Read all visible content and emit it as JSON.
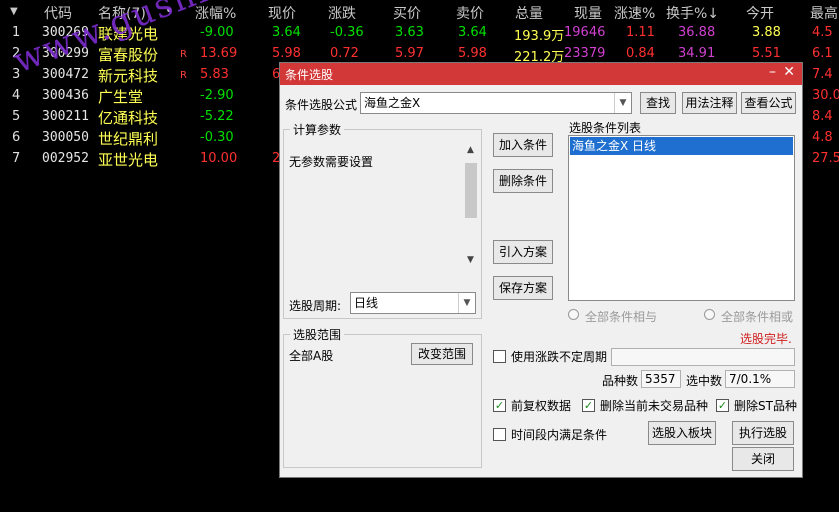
{
  "header": {
    "sort_arrow": "▼",
    "columns": [
      "代码",
      "名称(7)",
      "•",
      "涨幅%",
      "现价",
      "涨跌",
      "买价",
      "卖价",
      "总量",
      "现量",
      "涨速%",
      "换手%↓",
      "今开",
      "最高"
    ]
  },
  "rows": [
    {
      "idx": "1",
      "code": "300269",
      "name": "联建光电",
      "flag": "",
      "pct": "-9.00",
      "price": "3.64",
      "chg": "-0.36",
      "buy": "3.63",
      "sell": "3.64",
      "vol": "193.9万",
      "cur": "19646",
      "spd": "1.11",
      "turn": "36.88",
      "open": "3.88",
      "high": "4.5"
    },
    {
      "idx": "2",
      "code": "300299",
      "name": "富春股份",
      "flag": "R",
      "pct": "13.69",
      "price": "5.98",
      "chg": "0.72",
      "buy": "5.97",
      "sell": "5.98",
      "vol": "221.2万",
      "cur": "23379",
      "spd": "0.84",
      "turn": "34.91",
      "open": "5.51",
      "high": "6.1"
    },
    {
      "idx": "3",
      "code": "300472",
      "name": "新元科技",
      "flag": "R",
      "pct": "5.83",
      "price": "6.",
      "chg": "",
      "buy": "",
      "sell": "",
      "vol": "",
      "cur": "",
      "spd": "",
      "turn": "",
      "open": "",
      "high": "7.4"
    },
    {
      "idx": "4",
      "code": "300436",
      "name": "广生堂",
      "flag": "",
      "pct": "-2.90",
      "price": "",
      "chg": "",
      "buy": "",
      "sell": "",
      "vol": "",
      "cur": "",
      "spd": "",
      "turn": "",
      "open": "",
      "high": "30.0"
    },
    {
      "idx": "5",
      "code": "300211",
      "name": "亿通科技",
      "flag": "",
      "pct": "-5.22",
      "price": "",
      "chg": "",
      "buy": "",
      "sell": "",
      "vol": "",
      "cur": "",
      "spd": "",
      "turn": "",
      "open": "",
      "high": "8.4"
    },
    {
      "idx": "6",
      "code": "300050",
      "name": "世纪鼎利",
      "flag": "",
      "pct": "-0.30",
      "price": "",
      "chg": "",
      "buy": "",
      "sell": "",
      "vol": "",
      "cur": "",
      "spd": "",
      "turn": "",
      "open": "",
      "high": "4.8"
    },
    {
      "idx": "7",
      "code": "002952",
      "name": "亚世光电",
      "flag": "",
      "pct": "10.00",
      "price": "22",
      "chg": "",
      "buy": "",
      "sell": "",
      "vol": "",
      "cur": "",
      "spd": "",
      "turn": "",
      "open": "",
      "high": "27.5"
    }
  ],
  "watermark": "www.gushichanghong.com",
  "dialog": {
    "title": "条件选股",
    "formula_label": "条件选股公式",
    "formula_value": "海鱼之金X",
    "btn_find": "查找",
    "btn_usage": "用法注释",
    "btn_view": "查看公式",
    "params_title": "计算参数",
    "params_text": "无参数需要设置",
    "period_label": "选股周期:",
    "period_value": "日线",
    "btn_add": "加入条件",
    "btn_delete": "删除条件",
    "btn_import": "引入方案",
    "btn_save": "保存方案",
    "list_title": "选股条件列表",
    "list_items": [
      "海鱼之金X  日线"
    ],
    "radio_and": "全部条件相与",
    "radio_or": "全部条件相或",
    "status": "选股完毕.",
    "range_title": "选股范围",
    "range_value": "全部A股",
    "btn_range": "改变范围",
    "chk_period": "使用涨跌不定周期",
    "count_label": "品种数",
    "count_value": "5357",
    "selected_label": "选中数",
    "selected_value": "7/0.1%",
    "chk_adjust": "前复权数据",
    "chk_removenotrade": "删除当前未交易品种",
    "chk_removest": "删除ST品种",
    "chk_timerange": "时间段内满足条件",
    "btn_toblock": "选股入板块",
    "btn_execute": "执行选股",
    "btn_close": "关闭"
  }
}
